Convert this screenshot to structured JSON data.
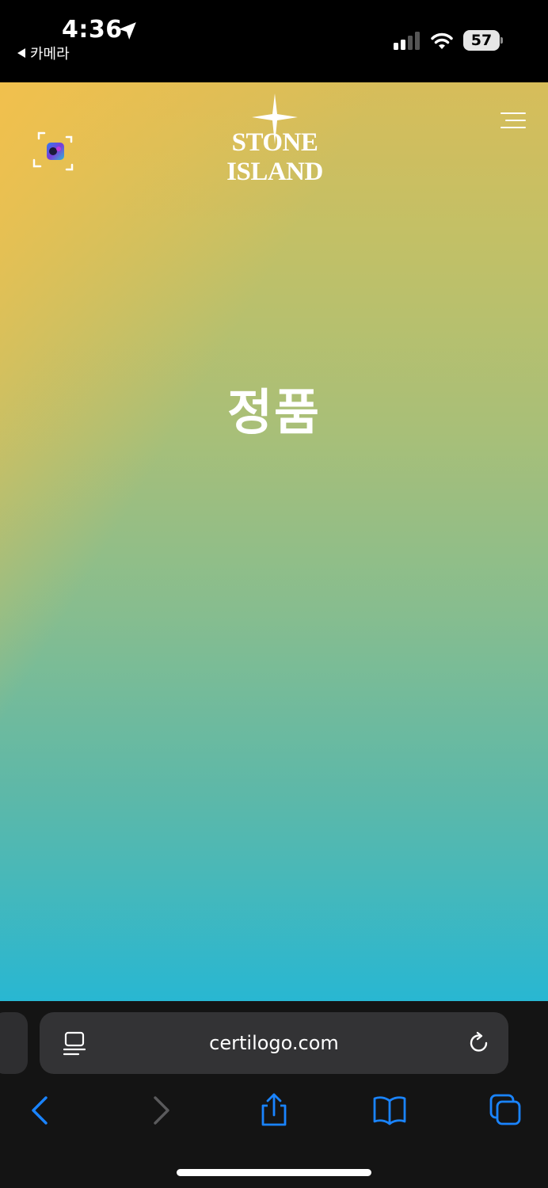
{
  "status_bar": {
    "time": "4:36",
    "back_app": "카메라",
    "battery": "57"
  },
  "header": {
    "brand": "STONE ISLAND",
    "scan_icon": "scan-qr-icon",
    "menu_icon": "hamburger-menu-icon"
  },
  "main": {
    "headline": "정품"
  },
  "browser": {
    "url": "certilogo.com",
    "reader_icon": "reader-mode-icon",
    "reload_icon": "reload-icon",
    "toolbar_icons": [
      "back-icon",
      "forward-icon",
      "share-icon",
      "bookmarks-icon",
      "tabs-icon"
    ]
  },
  "colors": {
    "accent": "#1a84ff",
    "gradient_top": "#e8bf4c",
    "gradient_bottom": "#22b8d6"
  }
}
